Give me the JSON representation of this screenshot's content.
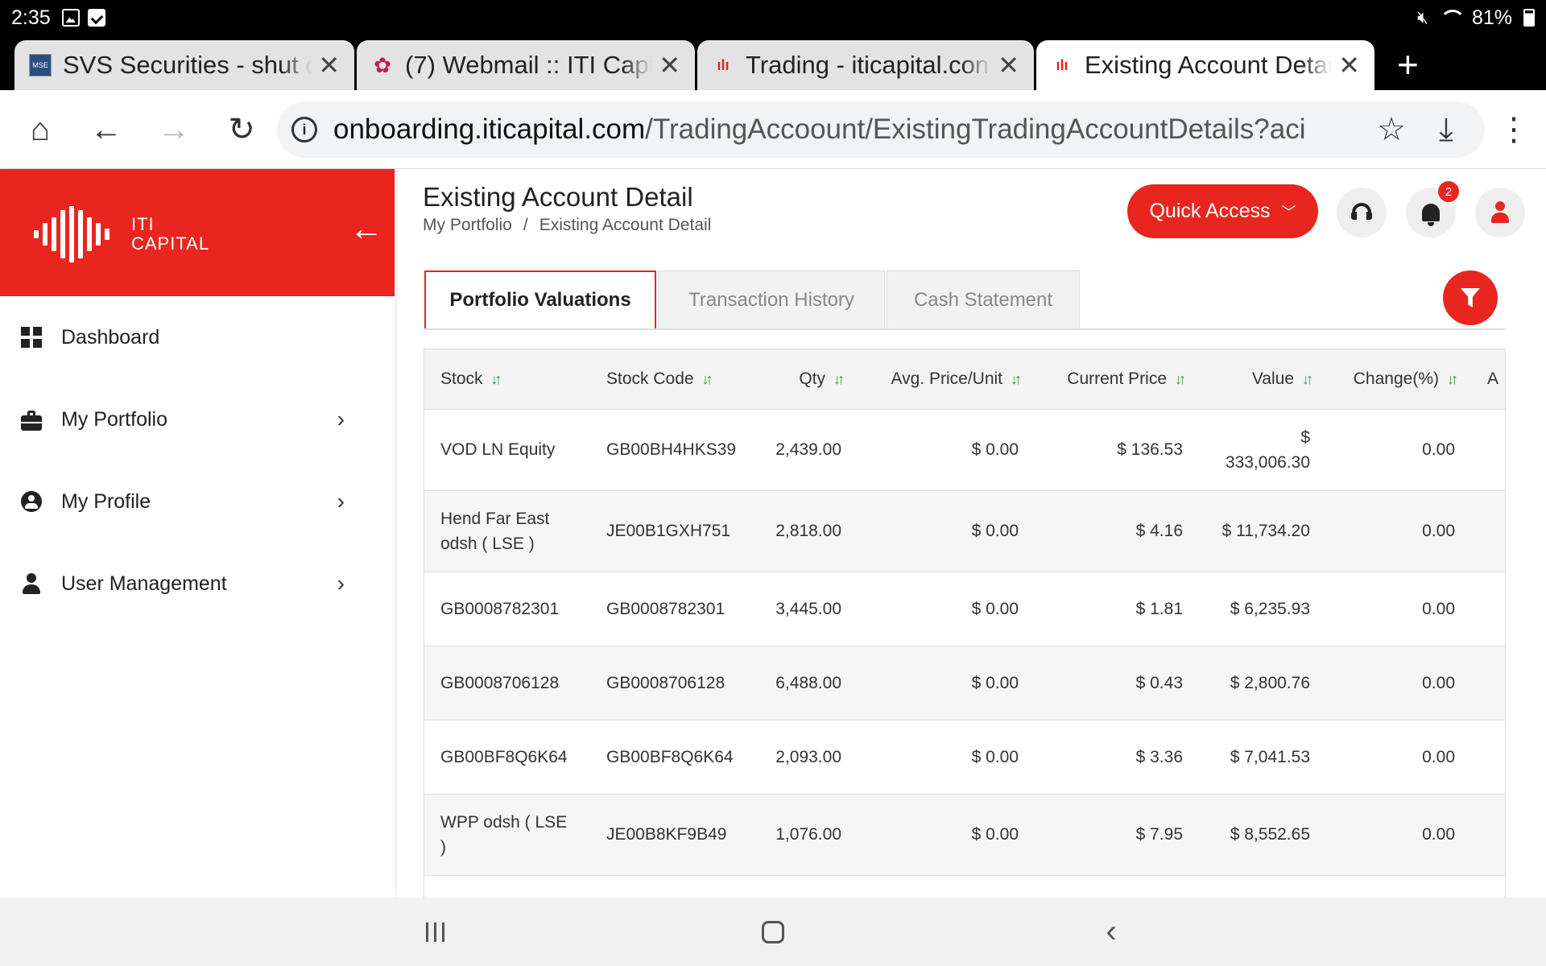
{
  "status_bar": {
    "time": "2:35",
    "battery": "81%"
  },
  "browser_tabs": [
    {
      "title": "SVS Securities - shut d",
      "favicon": "mse-icon"
    },
    {
      "title": "(7) Webmail :: ITI Capi",
      "favicon": "webmail-icon"
    },
    {
      "title": "Trading - iticapital.con",
      "favicon": "iti-icon"
    },
    {
      "title": "Existing Account Detai",
      "favicon": "iti-icon",
      "active": true
    }
  ],
  "address_bar": {
    "host": "onboarding.iticapital.com",
    "path": "/TradingAccoount/ExistingTradingAccountDetails?aci"
  },
  "brand": {
    "line1": "ITI",
    "line2": "CAPITAL",
    "color": "#e8261f"
  },
  "sidebar": {
    "items": [
      {
        "label": "Dashboard",
        "icon": "dashboard-icon",
        "has_chevron": false
      },
      {
        "label": "My Portfolio",
        "icon": "briefcase-icon",
        "has_chevron": true
      },
      {
        "label": "My Profile",
        "icon": "user-circle-icon",
        "has_chevron": true
      },
      {
        "label": "User Management",
        "icon": "user-icon",
        "has_chevron": true
      }
    ]
  },
  "header": {
    "title": "Existing Account Detail",
    "breadcrumb": [
      "My Portfolio",
      "/",
      "Existing Account Detail"
    ],
    "quick_access": "Quick Access",
    "notification_count": "2"
  },
  "content_tabs": [
    {
      "label": "Portfolio Valuations",
      "active": true
    },
    {
      "label": "Transaction History",
      "active": false
    },
    {
      "label": "Cash Statement",
      "active": false
    }
  ],
  "table": {
    "columns": [
      "Stock",
      "Stock Code",
      "Qty",
      "Avg. Price/Unit",
      "Current Price",
      "Value",
      "Change(%)",
      "A"
    ],
    "rows": [
      [
        "VOD LN Equity",
        "GB00BH4HKS39",
        "2,439.00",
        "$ 0.00",
        "$ 136.53",
        "$ 333,006.30",
        "0.00"
      ],
      [
        "Hend Far East odsh ( LSE )",
        "JE00B1GXH751",
        "2,818.00",
        "$ 0.00",
        "$ 4.16",
        "$ 11,734.20",
        "0.00"
      ],
      [
        "GB0008782301",
        "GB0008782301",
        "3,445.00",
        "$ 0.00",
        "$ 1.81",
        "$ 6,235.93",
        "0.00"
      ],
      [
        "GB0008706128",
        "GB0008706128",
        "6,488.00",
        "$ 0.00",
        "$ 0.43",
        "$ 2,800.76",
        "0.00"
      ],
      [
        "GB00BF8Q6K64",
        "GB00BF8Q6K64",
        "2,093.00",
        "$ 0.00",
        "$ 3.36",
        "$ 7,041.53",
        "0.00"
      ],
      [
        "WPP odsh ( LSE )",
        "JE00B8KF9B49",
        "1,076.00",
        "$ 0.00",
        "$ 7.95",
        "$ 8,552.65",
        "0.00"
      ]
    ]
  }
}
